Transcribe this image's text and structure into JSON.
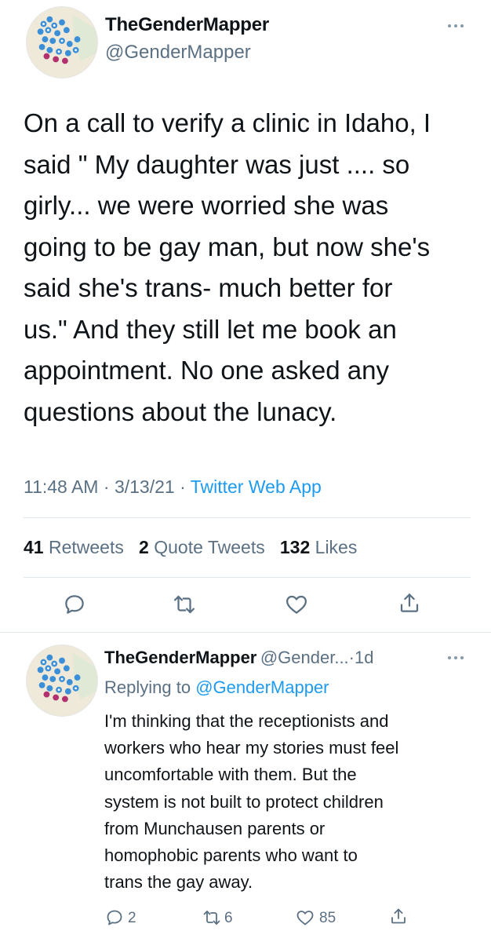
{
  "main_tweet": {
    "display_name": "TheGenderMapper",
    "handle": "@GenderMapper",
    "text": "On a call to verify a clinic in Idaho, I\nsaid \" My daughter was just .... so\ngirly... we were worried she was\ngoing to be gay man, but now she's\nsaid she's trans- much better for\nus.\" And they still let me book an\nappointment. No one asked any\nquestions about the lunacy.",
    "time": "11:48 AM",
    "date": "3/13/21",
    "separator": "·",
    "source": "Twitter Web App",
    "stats": {
      "retweets_count": "41",
      "retweets_label": "Retweets",
      "quotes_count": "2",
      "quotes_label": "Quote Tweets",
      "likes_count": "132",
      "likes_label": "Likes"
    }
  },
  "reply_tweet": {
    "display_name": "TheGenderMapper",
    "handle_truncated": "@Gender...",
    "age": "1d",
    "separator": "·",
    "replying_prefix": "Replying to",
    "replying_to": "@GenderMapper",
    "text": "I'm thinking that the receptionists and\nworkers who hear my stories must feel\nuncomfortable with them. But the\nsystem is not built to protect children\nfrom Munchausen parents or\nhomophobic parents who want to\ntrans the gay away.",
    "reply_count": "2",
    "retweet_count": "6",
    "like_count": "85"
  },
  "icons": {
    "reply": "reply-icon",
    "retweet": "retweet-icon",
    "like": "heart-icon",
    "share": "share-icon",
    "more": "more-icon"
  },
  "colors": {
    "text": "#0f1419",
    "secondary": "#5b7083",
    "link": "#1d9bf0",
    "divider": "#e1e8ed"
  }
}
